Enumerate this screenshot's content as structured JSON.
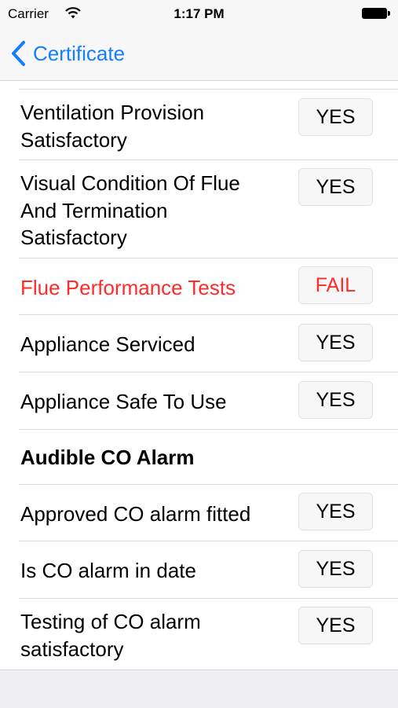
{
  "status_bar": {
    "carrier": "Carrier",
    "time": "1:17 PM",
    "icons": [
      "wifi-icon",
      "battery-icon"
    ]
  },
  "nav": {
    "back_label": "Certificate",
    "back_icon": "chevron-left-icon",
    "accent_color": "#147efb"
  },
  "rows": [
    {
      "label": "Ventilation Provision Satisfactory",
      "value": "YES"
    },
    {
      "label": "Visual Condition Of Flue And Termination Satisfactory",
      "value": "YES"
    },
    {
      "label": "Flue Performance Tests",
      "value": "FAIL",
      "status": "fail"
    },
    {
      "label": "Appliance Serviced",
      "value": "YES"
    },
    {
      "label": "Appliance Safe To Use",
      "value": "YES"
    }
  ],
  "section": {
    "title": "Audible CO Alarm"
  },
  "co_rows": [
    {
      "label": "Approved CO alarm fitted",
      "value": "YES"
    },
    {
      "label": "Is CO alarm in date",
      "value": "YES"
    },
    {
      "label": "Testing of CO alarm satisfactory",
      "value": "YES"
    }
  ],
  "colors": {
    "fail": "#ff2a2a",
    "accent": "#147efb"
  }
}
